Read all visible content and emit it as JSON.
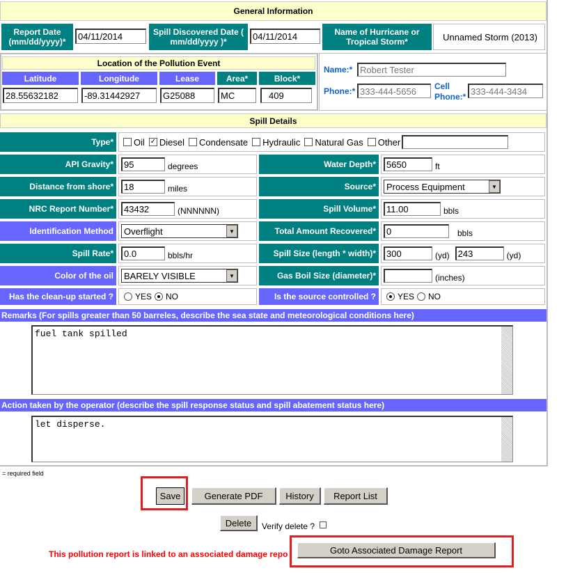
{
  "general": {
    "title": "General Information",
    "report_date_label": "Report Date (mm/dd/yyyy)*",
    "report_date": "04/11/2014",
    "spill_date_label": "Spill Discovered Date ( mm/dd/yyyy )*",
    "spill_date": "04/11/2014",
    "storm_label": "Name of Hurricane or Tropical Storm*",
    "storm": "Unnamed Storm (2013)"
  },
  "location": {
    "title": "Location of the Pollution Event",
    "columns": [
      "Latitude",
      "Longitude",
      "Lease",
      "Area*",
      "Block*"
    ],
    "values": [
      "28.55632182",
      "-89.31442927",
      "G25088",
      "MC",
      "409"
    ]
  },
  "contact": {
    "name_label": "Name:*",
    "name": "Robert Tester",
    "phone_label": "Phone:*",
    "phone": "333-444-5656",
    "cell_label": "Cell Phone:*",
    "cell": "333-444-3434"
  },
  "spill": {
    "title": "Spill Details",
    "type_label": "Type*",
    "types": [
      {
        "label": "Oil",
        "checked": false
      },
      {
        "label": "Diesel",
        "checked": true
      },
      {
        "label": "Condensate",
        "checked": false
      },
      {
        "label": "Hydraulic",
        "checked": false
      },
      {
        "label": "Natural Gas",
        "checked": false
      },
      {
        "label": "Other",
        "checked": false
      }
    ],
    "other_value": "",
    "api_label": "API Gravity*",
    "api": "95",
    "api_unit": "degrees",
    "depth_label": "Water Depth*",
    "depth": "5650",
    "depth_unit": "ft",
    "distance_label": "Distance from shore*",
    "distance": "18",
    "distance_unit": "miles",
    "source_label": "Source*",
    "source": "Process Equipment",
    "nrc_label": "NRC Report Number*",
    "nrc": "43432",
    "nrc_unit": "(NNNNNN)",
    "volume_label": "Spill Volume*",
    "volume": "11.00",
    "volume_unit": "bbls",
    "idmethod_label": "Identification Method",
    "idmethod": "Overflight",
    "recovered_label": "Total Amount Recovered*",
    "recovered": "0",
    "recovered_unit": "bbls",
    "rate_label": "Spill Rate*",
    "rate": "0.0",
    "rate_unit": "bbls/hr",
    "size_label": "Spill Size (length * width)*",
    "length": "300",
    "width": "243",
    "size_unit": "(yd)",
    "color_label": "Color of the oil",
    "color": "BARELY VISIBLE",
    "boil_label": "Gas Boil Size (diameter)*",
    "boil": "",
    "boil_unit": "(inches)",
    "cleanup_label": "Has the clean-up started ?",
    "cleanup": "NO",
    "controlled_label": "Is the source controlled ?",
    "controlled": "YES",
    "yes": "YES",
    "no": "NO"
  },
  "remarks": {
    "label": "Remarks (For spills greater than 50 barreles, describe the sea state and meteorological conditions here)",
    "value": "fuel tank spilled"
  },
  "action": {
    "label": "Action taken by the operator (describe the spill response status and spill abatement status here)",
    "value": "let disperse."
  },
  "footer": {
    "required_note": "* = required field",
    "save": "Save",
    "pdf": "Generate PDF",
    "history": "History",
    "report_list": "Report List",
    "delete": "Delete",
    "verify_delete": "Verify delete ?",
    "linked_msg": "This pollution report is linked to an associated damage report",
    "goto": "Goto Associated Damage Report"
  },
  "colors": {
    "teal": "#008080",
    "blue": "#6666ff",
    "header": "#ffffcc",
    "highlight": "#e02020",
    "message": "#ff0000"
  }
}
